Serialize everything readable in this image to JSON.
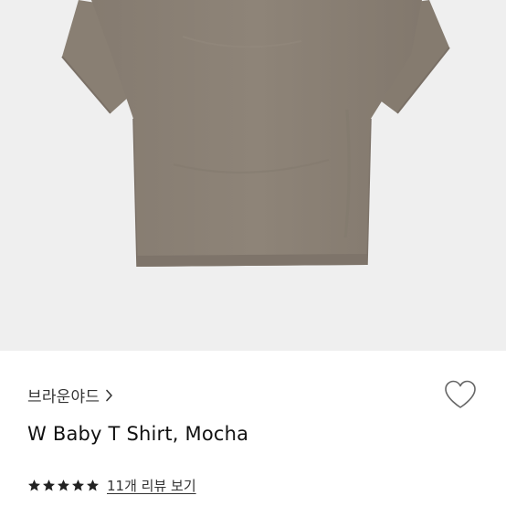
{
  "product": {
    "image": {
      "subject": "tshirt",
      "background_color": "#efefef",
      "shirt_color": "#8c8276"
    },
    "brand": {
      "label": "브라운야드",
      "chevron_icon": "chevron-right-icon"
    },
    "wishlist": {
      "icon": "heart-outline-icon"
    },
    "title": "W Baby T Shirt, Mocha",
    "rating": {
      "stars": 5,
      "max_stars": 5,
      "star_color": "#222222",
      "review_link_label": "11개 리뷰 보기"
    }
  }
}
